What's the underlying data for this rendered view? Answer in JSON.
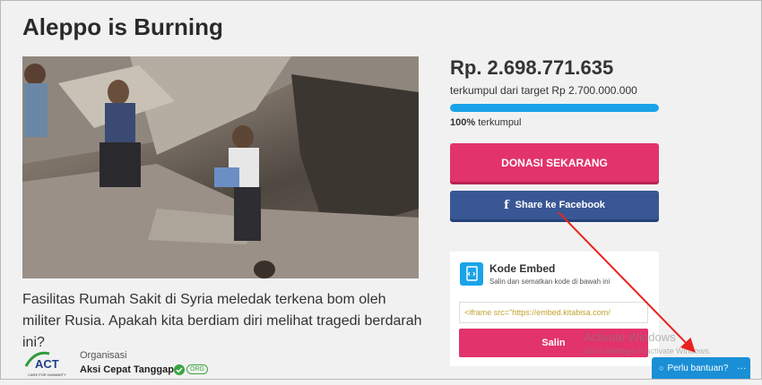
{
  "page": {
    "title": "Aleppo is Burning"
  },
  "campaign": {
    "description": "Fasilitas Rumah Sakit di Syria meledak terkena bom oleh militer Rusia. Apakah kita berdiam diri melihat tragedi berdarah ini?",
    "amount": "Rp. 2.698.771.635",
    "target": "terkumpul dari target Rp 2.700.000.000",
    "progress_pct_label": "100%",
    "progress_suffix": " terkumpul",
    "progress_fraction": 1.0
  },
  "organization": {
    "label": "Organisasi",
    "name": "Aksi Cepat Tanggap",
    "badge": "ORG",
    "logo_text": "ACT",
    "logo_tagline": "CARE FOR HUMANITY"
  },
  "actions": {
    "donate_label": "DONASI SEKARANG",
    "facebook_label": "Share ke Facebook",
    "facebook_icon": "f"
  },
  "embed": {
    "title": "Kode Embed",
    "subtitle": "Salin dan sematkan kode di bawah ini",
    "code_value": "<iframe src=\"https://embed.kitabisa.com/",
    "copy_label": "Salin"
  },
  "os_watermark": {
    "line1": "Activate Windows",
    "line2": "Go to Settings to activate Windows."
  },
  "help_widget": {
    "label": "Perlu bantuan?",
    "more": "···"
  },
  "colors": {
    "donate": "#e2336b",
    "facebook": "#3a5795",
    "progress": "#1aa3e8",
    "annotation_arrow": "#e8231f"
  }
}
